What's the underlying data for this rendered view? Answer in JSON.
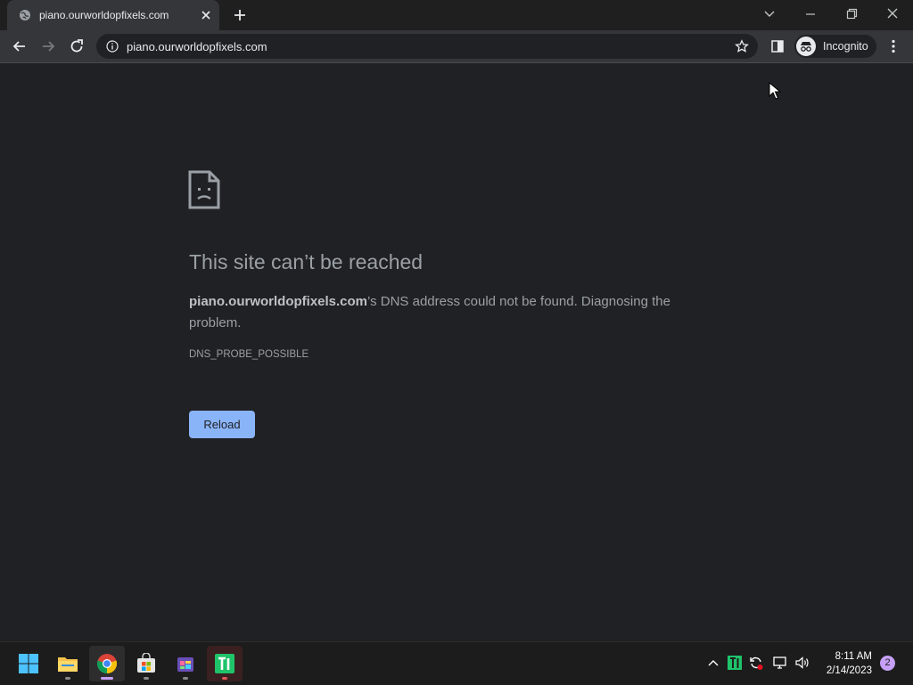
{
  "browser": {
    "tab": {
      "title": "piano.ourworldopfixels.com",
      "favicon": "globe-icon"
    },
    "omnibox": {
      "url": "piano.ourworldopfixels.com"
    },
    "profile": {
      "label": "Incognito"
    }
  },
  "page": {
    "title": "This site can’t be reached",
    "message_host": "piano.ourworldopfixels.com",
    "message_rest": "’s DNS address could not be found. Diagnosing the problem.",
    "error_code": "DNS_PROBE_POSSIBLE",
    "reload_label": "Reload"
  },
  "taskbar": {
    "apps": [
      "start-icon",
      "file-explorer-icon",
      "chrome-icon",
      "microsoft-store-icon",
      "app-icon",
      "terminal-icon"
    ],
    "clock": {
      "time": "8:11 AM",
      "date": "2/14/2023"
    },
    "notification_count": "2"
  },
  "colors": {
    "page_bg": "#202124",
    "toolbar_bg": "#35363a",
    "accent": "#8ab4f8",
    "notification_badge": "#c6a0f6"
  }
}
